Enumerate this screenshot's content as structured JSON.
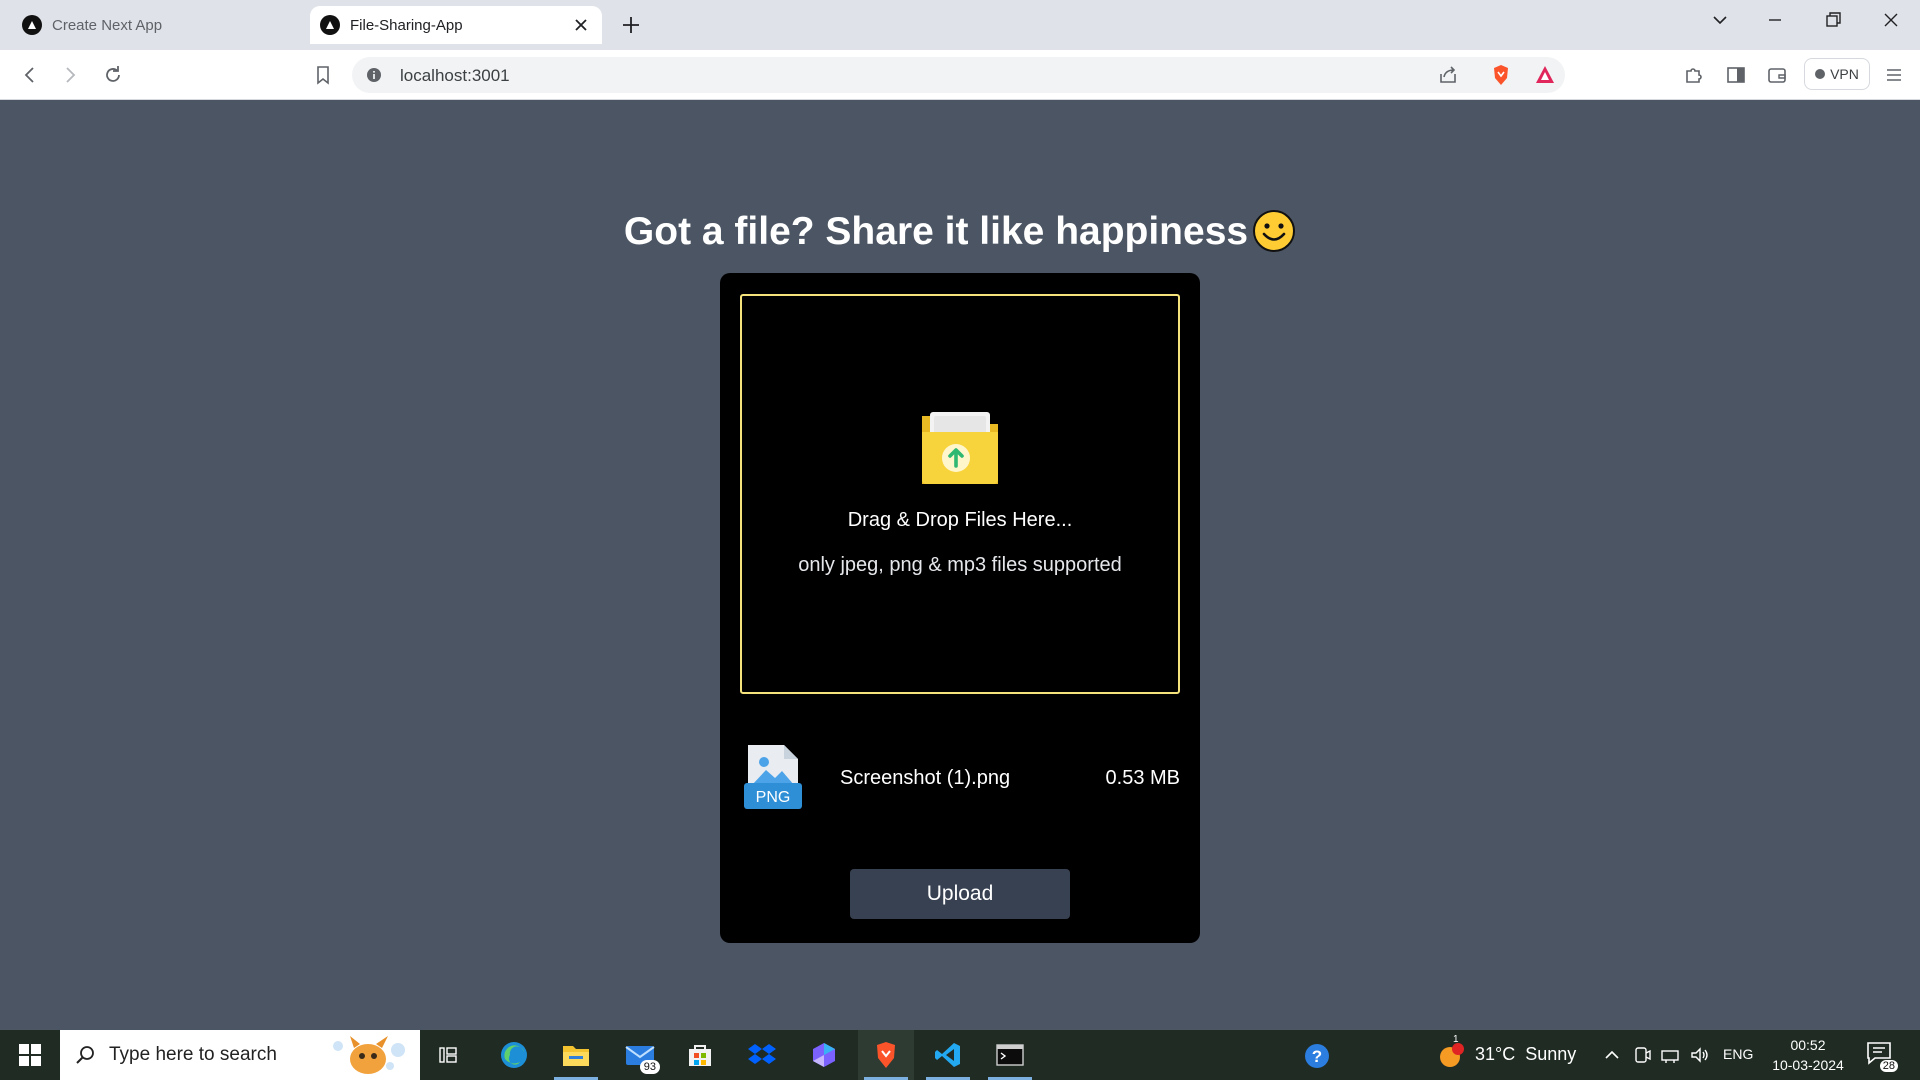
{
  "browser": {
    "tabs": [
      {
        "title": "Create Next App",
        "active": false
      },
      {
        "title": "File-Sharing-App",
        "active": true
      }
    ],
    "url": "localhost:3001",
    "vpn_label": "VPN"
  },
  "page": {
    "headline": "Got a file? Share it like happiness",
    "dropzone": {
      "title": "Drag & Drop Files Here...",
      "subtitle": "only jpeg, png & mp3 files supported"
    },
    "file": {
      "type_label": "PNG",
      "name": "Screenshot (1).png",
      "size": "0.53 MB"
    },
    "upload_label": "Upload"
  },
  "taskbar": {
    "search_placeholder": "Type here to search",
    "mail_badge": "93",
    "weather_badge": "1",
    "weather": "31°C  Sunny",
    "language": "ENG",
    "time": "00:52",
    "date": "10-03-2024",
    "notifications": "28"
  },
  "colors": {
    "page_bg": "#4b5563",
    "card_bg": "#000000",
    "dropzone_border": "#f5e27a",
    "upload_bg": "#374151"
  }
}
